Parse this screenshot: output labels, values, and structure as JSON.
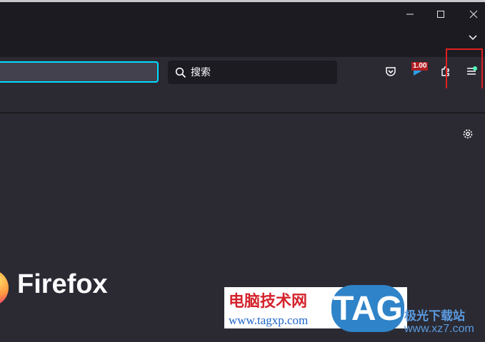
{
  "window": {
    "minimize_icon": "minimize-icon",
    "maximize_icon": "maximize-icon",
    "close_icon": "close-icon",
    "list_all_tabs_icon": "chevron-down-icon"
  },
  "toolbar": {
    "search_placeholder": "搜索",
    "extension_badge": "1.00",
    "icons": [
      "search-icon",
      "pocket-icon",
      "extension-play-icon",
      "extensions-puzzle-icon",
      "hamburger-menu-icon"
    ]
  },
  "content": {
    "settings_icon": "gear-icon",
    "brand_wordmark": "Firefox"
  },
  "watermark": {
    "cn_title": "电脑技术网",
    "url": "www.tagxp.com",
    "tag_logo": "TAG",
    "site_cn": "极光下载站",
    "site_url": "www.xz7.com"
  },
  "colors": {
    "titlebar_bg": "#1c1b22",
    "toolbar_bg": "#2b2a33",
    "urlbar_focus": "#00ddff",
    "highlight_red": "#e02020",
    "update_dot": "#54ffbd"
  }
}
